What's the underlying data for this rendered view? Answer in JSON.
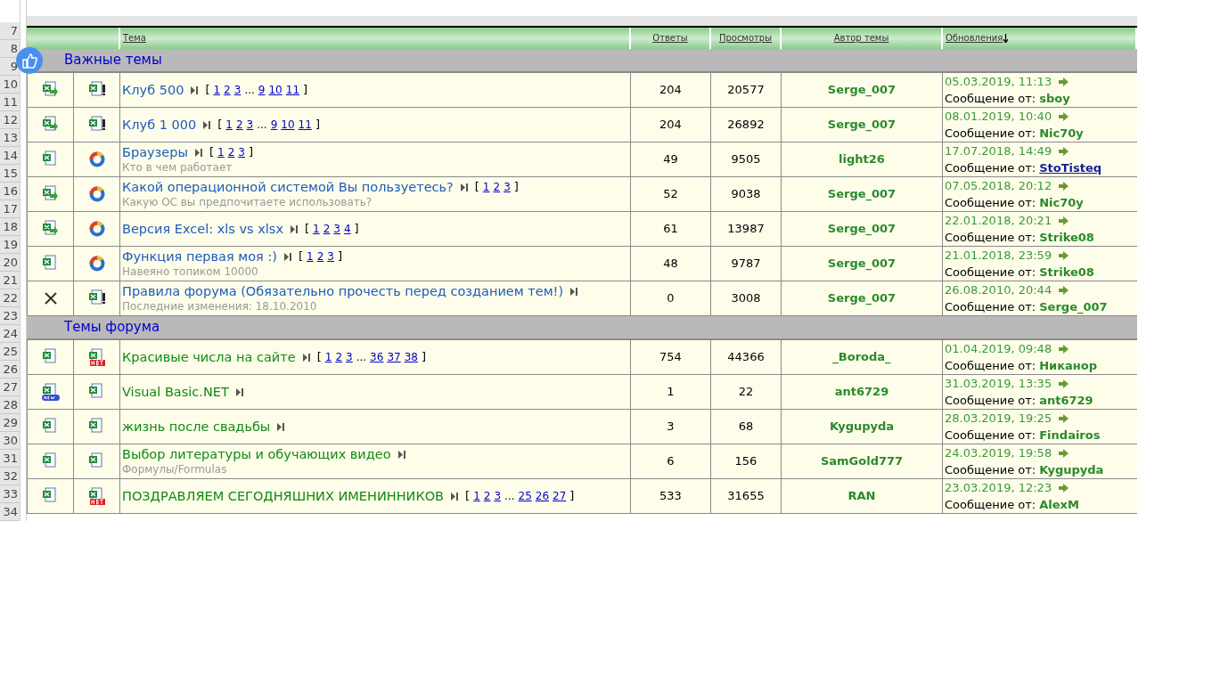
{
  "sheet": {
    "row_numbers": [
      "7",
      "8",
      "9",
      "10",
      "11",
      "12",
      "13",
      "14",
      "15",
      "16",
      "17",
      "18",
      "19",
      "20",
      "21",
      "22",
      "23",
      "24",
      "25",
      "26",
      "27",
      "28",
      "29",
      "30",
      "31",
      "32",
      "33",
      "34"
    ]
  },
  "table": {
    "columns": [
      "Тема",
      "Ответы",
      "Просмотры",
      "Автор темы",
      "Обновления"
    ],
    "sections": [
      {
        "title": "Важные темы",
        "kind": "important",
        "topics": [
          {
            "status_icon": {
              "kind": "updated"
            },
            "type_icon": {
              "kind": "sticky"
            },
            "title": "Клуб 500",
            "pages": [
              {
                "text": "[",
                "kind": "bracket"
              },
              {
                "text": "1",
                "kind": "link"
              },
              {
                "text": "2",
                "kind": "link"
              },
              {
                "text": "3",
                "kind": "link"
              },
              {
                "text": "...",
                "kind": "gap"
              },
              {
                "text": "9",
                "kind": "link"
              },
              {
                "text": "10",
                "kind": "link"
              },
              {
                "text": "11",
                "kind": "link"
              },
              {
                "text": "]",
                "kind": "bracket"
              }
            ],
            "replies": "204",
            "views": "20577",
            "author": "Serge_007",
            "last_date": "05.03.2019, 11:13",
            "last_label": "Сообщение от:",
            "last_by": {
              "text": "sboy",
              "kind": "user"
            }
          },
          {
            "status_icon": {
              "kind": "updated"
            },
            "type_icon": {
              "kind": "sticky"
            },
            "title": "Клуб 1 000",
            "pages": [
              {
                "text": "[",
                "kind": "bracket"
              },
              {
                "text": "1",
                "kind": "link"
              },
              {
                "text": "2",
                "kind": "link"
              },
              {
                "text": "3",
                "kind": "link"
              },
              {
                "text": "...",
                "kind": "gap"
              },
              {
                "text": "9",
                "kind": "link"
              },
              {
                "text": "10",
                "kind": "link"
              },
              {
                "text": "11",
                "kind": "link"
              },
              {
                "text": "]",
                "kind": "bracket"
              }
            ],
            "replies": "204",
            "views": "26892",
            "author": "Serge_007",
            "last_date": "08.01.2019, 10:40",
            "last_label": "Сообщение от:",
            "last_by": {
              "text": "Nic70y",
              "kind": "user"
            }
          },
          {
            "status_icon": {
              "kind": "plain"
            },
            "type_icon": {
              "kind": "poll"
            },
            "title": "Браузеры",
            "pages": [
              {
                "text": "[",
                "kind": "bracket"
              },
              {
                "text": "1",
                "kind": "link"
              },
              {
                "text": "2",
                "kind": "link"
              },
              {
                "text": "3",
                "kind": "link"
              },
              {
                "text": "]",
                "kind": "bracket"
              }
            ],
            "description": "Кто в чем работает",
            "replies": "49",
            "views": "9505",
            "author": "light26",
            "last_date": "17.07.2018, 14:49",
            "last_label": "Сообщение от:",
            "last_by": {
              "text": "StoTisteq",
              "kind": "link"
            }
          },
          {
            "status_icon": {
              "kind": "updated"
            },
            "type_icon": {
              "kind": "poll"
            },
            "title": "Какой операционной системой Вы пользуетесь?",
            "pages": [
              {
                "text": "[",
                "kind": "bracket"
              },
              {
                "text": "1",
                "kind": "link"
              },
              {
                "text": "2",
                "kind": "link"
              },
              {
                "text": "3",
                "kind": "link"
              },
              {
                "text": "]",
                "kind": "bracket"
              }
            ],
            "description": "Какую ОС вы предпочитаете использовать?",
            "replies": "52",
            "views": "9038",
            "author": "Serge_007",
            "last_date": "07.05.2018, 20:12",
            "last_label": "Сообщение от:",
            "last_by": {
              "text": "Nic70y",
              "kind": "user"
            }
          },
          {
            "status_icon": {
              "kind": "updated"
            },
            "type_icon": {
              "kind": "poll"
            },
            "title": "Версия Excel: xls vs xlsx",
            "pages": [
              {
                "text": "[",
                "kind": "bracket"
              },
              {
                "text": "1",
                "kind": "link"
              },
              {
                "text": "2",
                "kind": "link"
              },
              {
                "text": "3",
                "kind": "link"
              },
              {
                "text": "4",
                "kind": "link"
              },
              {
                "text": "]",
                "kind": "bracket"
              }
            ],
            "replies": "61",
            "views": "13987",
            "author": "Serge_007",
            "last_date": "22.01.2018, 20:21",
            "last_label": "Сообщение от:",
            "last_by": {
              "text": "Strike08",
              "kind": "user"
            }
          },
          {
            "status_icon": {
              "kind": "plain"
            },
            "type_icon": {
              "kind": "poll"
            },
            "title": "Функция первая моя :)",
            "pages": [
              {
                "text": "[",
                "kind": "bracket"
              },
              {
                "text": "1",
                "kind": "link"
              },
              {
                "text": "2",
                "kind": "link"
              },
              {
                "text": "3",
                "kind": "link"
              },
              {
                "text": "]",
                "kind": "bracket"
              }
            ],
            "description": "Навеяно топиком 10000",
            "replies": "48",
            "views": "9787",
            "author": "Serge_007",
            "last_date": "21.01.2018, 23:59",
            "last_label": "Сообщение от:",
            "last_by": {
              "text": "Strike08",
              "kind": "user"
            }
          },
          {
            "status_icon": {
              "kind": "closed"
            },
            "type_icon": {
              "kind": "sticky"
            },
            "title": "Правила форума (Обязательно прочесть перед созданием тем!)",
            "description": "Последние изменения: 18.10.2010",
            "replies": "0",
            "views": "3008",
            "author": "Serge_007",
            "last_date": "26.08.2010, 20:44",
            "last_label": "Сообщение от:",
            "last_by": {
              "text": "Serge_007",
              "kind": "user"
            }
          }
        ]
      },
      {
        "title": "Темы форума",
        "kind": "normal",
        "topics": [
          {
            "status_icon": {
              "kind": "plain"
            },
            "type_icon": {
              "kind": "hot"
            },
            "title": "Красивые числа на сайте",
            "pages": [
              {
                "text": "[",
                "kind": "bracket"
              },
              {
                "text": "1",
                "kind": "link"
              },
              {
                "text": "2",
                "kind": "link"
              },
              {
                "text": "3",
                "kind": "link"
              },
              {
                "text": "...",
                "kind": "gap"
              },
              {
                "text": "36",
                "kind": "link"
              },
              {
                "text": "37",
                "kind": "link"
              },
              {
                "text": "38",
                "kind": "link"
              },
              {
                "text": "]",
                "kind": "bracket"
              }
            ],
            "replies": "754",
            "views": "44366",
            "author": "_Boroda_",
            "last_date": "01.04.2019, 09:48",
            "last_label": "Сообщение от:",
            "last_by": {
              "text": "Никанор",
              "kind": "user"
            }
          },
          {
            "status_icon": {
              "kind": "new"
            },
            "type_icon": {
              "kind": "normal"
            },
            "title": "Visual Basic.NET",
            "replies": "1",
            "views": "22",
            "author": "ant6729",
            "last_date": "31.03.2019, 13:35",
            "last_label": "Сообщение от:",
            "last_by": {
              "text": "ant6729",
              "kind": "user"
            }
          },
          {
            "status_icon": {
              "kind": "plain"
            },
            "type_icon": {
              "kind": "normal"
            },
            "title": "жизнь после свадьбы",
            "replies": "3",
            "views": "68",
            "author": "Kygupyda",
            "last_date": "28.03.2019, 19:25",
            "last_label": "Сообщение от:",
            "last_by": {
              "text": "Findairos",
              "kind": "user"
            }
          },
          {
            "status_icon": {
              "kind": "plain"
            },
            "type_icon": {
              "kind": "normal"
            },
            "title": "Выбор литературы и обучающих видео",
            "description": "Формулы/Formulas",
            "replies": "6",
            "views": "156",
            "author": "SamGold777",
            "last_date": "24.03.2019, 19:58",
            "last_label": "Сообщение от:",
            "last_by": {
              "text": "Kygupyda",
              "kind": "user"
            }
          },
          {
            "status_icon": {
              "kind": "plain"
            },
            "type_icon": {
              "kind": "hot"
            },
            "title": "ПОЗДРАВЛЯЕМ СЕГОДНЯШНИХ ИМЕНИННИКОВ",
            "pages": [
              {
                "text": "[",
                "kind": "bracket"
              },
              {
                "text": "1",
                "kind": "link"
              },
              {
                "text": "2",
                "kind": "link"
              },
              {
                "text": "3",
                "kind": "link"
              },
              {
                "text": "...",
                "kind": "gap"
              },
              {
                "text": "25",
                "kind": "link"
              },
              {
                "text": "26",
                "kind": "link"
              },
              {
                "text": "27",
                "kind": "link"
              },
              {
                "text": "]",
                "kind": "bracket"
              }
            ],
            "replies": "533",
            "views": "31655",
            "author": "RAN",
            "last_date": "23.03.2019, 12:23",
            "last_label": "Сообщение от:",
            "last_by": {
              "text": "AlexM",
              "kind": "user"
            }
          }
        ]
      }
    ]
  }
}
